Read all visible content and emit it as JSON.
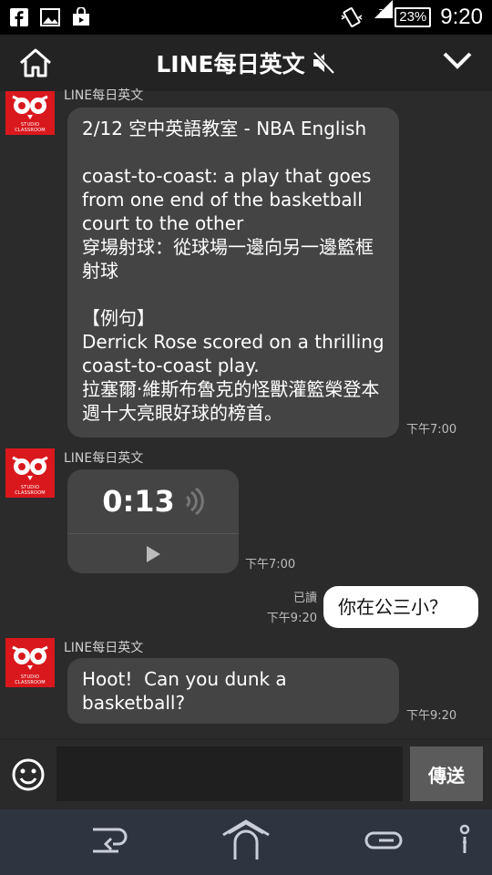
{
  "status_bar": {
    "network": "3G",
    "battery": "23%",
    "time": "9:20"
  },
  "header": {
    "title": "LINE每日英文"
  },
  "messages": [
    {
      "sender": "LINE每日英文",
      "text": "2/12 空中英語教室 - NBA English\n\ncoast-to-coast: a play that goes from one end of the basketball court to the other\n穿場射球：從球場一邊向另一邊籃框射球\n\n【例句】\nDerrick Rose scored on a thrilling coast-to-coast play.\n拉塞爾·維斯布魯克的怪獸灌籃榮登本週十大亮眼好球的榜首。",
      "time": "下午7:00"
    },
    {
      "sender": "LINE每日英文",
      "voice_duration": "0:13",
      "time": "下午7:00"
    },
    {
      "read_label": "已讀",
      "text": "你在公三小？",
      "time": "下午9:20"
    },
    {
      "sender": "LINE每日英文",
      "text": "Hoot!  Can you dunk a basketball?",
      "time": "下午9:20"
    }
  ],
  "avatar_caption": "STUDIO CLASSROOM",
  "input": {
    "placeholder": "",
    "send_label": "傳送"
  },
  "colors": {
    "avatar_bg": "#d9181d",
    "incoming_bubble": "#444444",
    "outgoing_bubble": "#ffffff",
    "background": "#2b2b2b"
  }
}
